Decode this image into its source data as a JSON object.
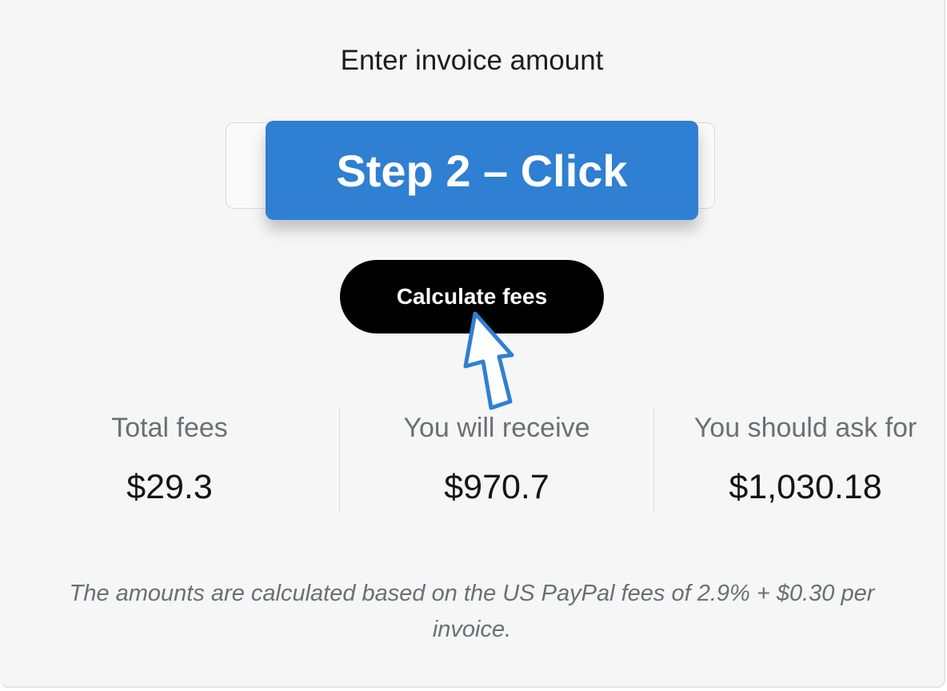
{
  "form": {
    "heading": "Enter invoice amount",
    "amount_input_value": "",
    "step_overlay_text": "Step 2 – Click",
    "calculate_button_label": "Calculate fees"
  },
  "results": [
    {
      "label": "Total fees",
      "value": "$29.3"
    },
    {
      "label": "You will receive",
      "value": "$970.7"
    },
    {
      "label": "You should ask for",
      "value": "$1,030.18"
    }
  ],
  "footnote": "The amounts are calculated based on the US PayPal fees of 2.9% + $0.30 per invoice.",
  "colors": {
    "overlay_blue": "#2f7fd2",
    "button_black": "#000000",
    "background": "#f6f6f6"
  },
  "icons": {
    "pointer": "arrow-pointer-icon"
  }
}
